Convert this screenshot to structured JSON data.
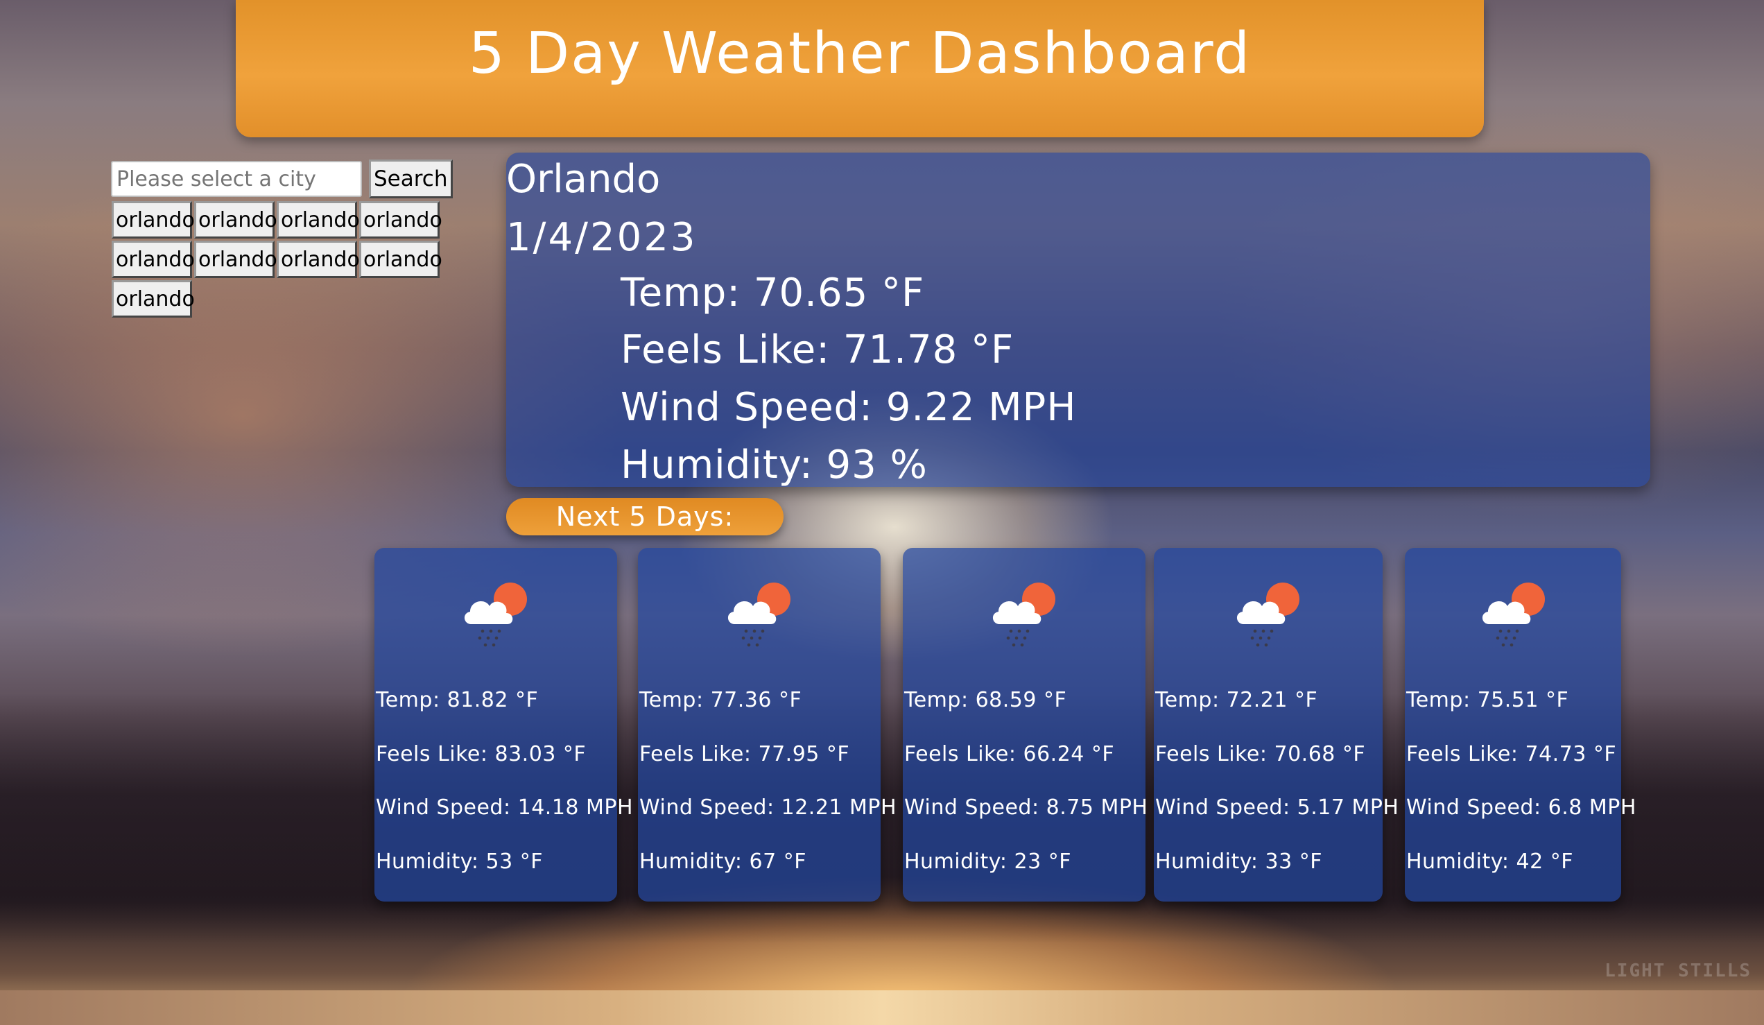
{
  "header": {
    "title": "5 Day Weather Dashboard"
  },
  "search": {
    "placeholder": "Please select a city",
    "value": "",
    "button_label": "Search"
  },
  "history": [
    {
      "label": "orlando"
    },
    {
      "label": "orlando"
    },
    {
      "label": "orlando"
    },
    {
      "label": "orlando"
    },
    {
      "label": "orlando"
    },
    {
      "label": "orlando"
    },
    {
      "label": "orlando"
    },
    {
      "label": "orlando"
    },
    {
      "label": "orlando"
    }
  ],
  "current": {
    "city": "Orlando",
    "date": "1/4/2023",
    "temp": "Temp: 70.65 °F",
    "feels_like": "Feels Like: 71.78 °F",
    "wind": "Wind Speed: 9.22 MPH",
    "humidity": "Humidity: 93 %"
  },
  "next_label": "Next 5 Days:",
  "forecast": [
    {
      "icon": "partly-cloudy-rain-icon",
      "temp": "Temp: 81.82 °F",
      "feels_like": "Feels Like: 83.03 °F",
      "wind": "Wind Speed: 14.18 MPH",
      "humidity": "Humidity: 53 °F"
    },
    {
      "icon": "partly-cloudy-rain-icon",
      "temp": "Temp: 77.36 °F",
      "feels_like": "Feels Like: 77.95 °F",
      "wind": "Wind Speed: 12.21 MPH",
      "humidity": "Humidity: 67 °F"
    },
    {
      "icon": "partly-cloudy-rain-icon",
      "temp": "Temp: 68.59 °F",
      "feels_like": "Feels Like: 66.24 °F",
      "wind": "Wind Speed: 8.75 MPH",
      "humidity": "Humidity: 23 °F"
    },
    {
      "icon": "partly-cloudy-rain-icon",
      "temp": "Temp: 72.21 °F",
      "feels_like": "Feels Like: 70.68 °F",
      "wind": "Wind Speed: 5.17 MPH",
      "humidity": "Humidity: 33 °F"
    },
    {
      "icon": "partly-cloudy-rain-icon",
      "temp": "Temp: 75.51 °F",
      "feels_like": "Feels Like: 74.73 °F",
      "wind": "Wind Speed: 6.8 MPH",
      "humidity": "Humidity: 42 °F"
    }
  ],
  "watermark": "LIGHT STILLS",
  "colors": {
    "header": "#f0a23c",
    "panel": "#2346a0",
    "text": "#ffffff"
  }
}
